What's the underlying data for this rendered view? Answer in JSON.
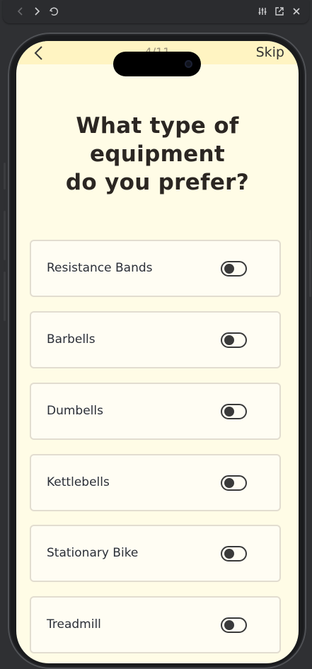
{
  "toolbar": {
    "icons": [
      "chevron-left-icon",
      "chevron-right-icon",
      "undo-icon",
      "sliders-icon",
      "open-external-icon",
      "close-icon"
    ]
  },
  "header": {
    "counter": "4/11",
    "skip_label": "Skip"
  },
  "question": {
    "title": "What type of\nequipment\ndo you prefer?"
  },
  "options": [
    {
      "label": "Resistance Bands",
      "selected": false
    },
    {
      "label": "Barbells",
      "selected": false
    },
    {
      "label": "Dumbells",
      "selected": false
    },
    {
      "label": "Kettlebells",
      "selected": false
    },
    {
      "label": "Stationary Bike",
      "selected": false
    },
    {
      "label": "Treadmill",
      "selected": false
    }
  ],
  "colors": {
    "background": "#fffce6",
    "status_band": "#fff4c2",
    "text": "#2b2622",
    "toggle": "#3a3a3a"
  }
}
